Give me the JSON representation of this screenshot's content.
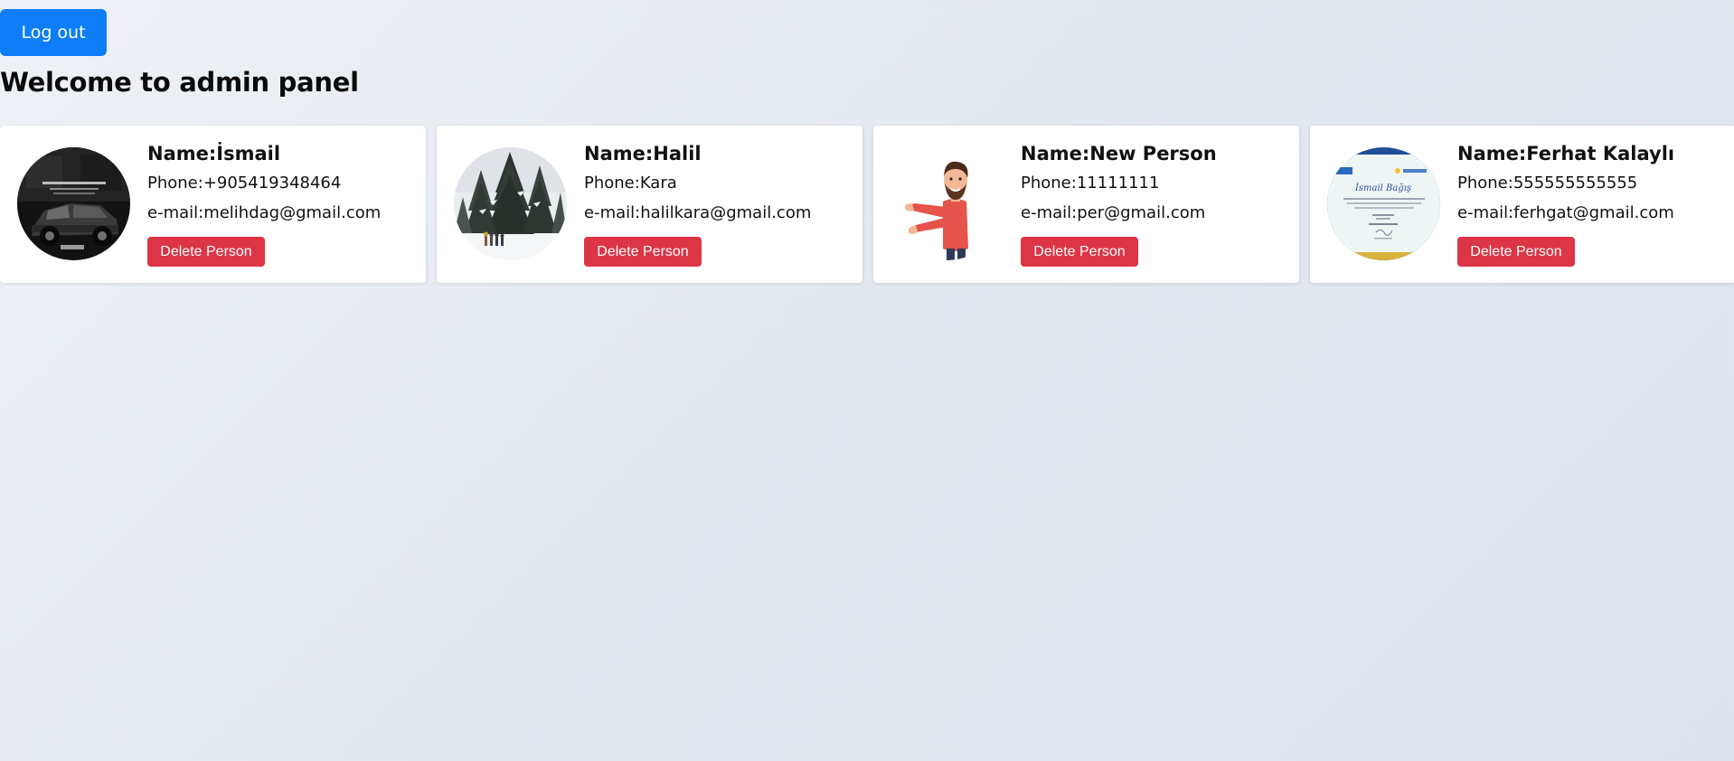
{
  "header": {
    "logout_label": "Log out",
    "title": "Welcome to admin panel"
  },
  "cards": [
    {
      "name": "Name:İsmail",
      "phone": "Phone:+905419348464",
      "email": "e-mail:melihdag@gmail.com",
      "delete_label": "Delete Person",
      "avatar_desc": "car-photo",
      "avatar_caption": "",
      "avatar_caption2": ""
    },
    {
      "name": "Name:Halil",
      "phone": "Phone:Kara",
      "email": "e-mail:halilkara@gmail.com",
      "delete_label": "Delete Person",
      "avatar_desc": "snowy-forest-photo"
    },
    {
      "name": "Name:New Person",
      "phone": "Phone:11111111",
      "email": "e-mail:per@gmail.com",
      "delete_label": "Delete Person",
      "avatar_desc": "cartoon-man-illustration"
    },
    {
      "name": "Name:Ferhat Kalaylı",
      "phone": "Phone:555555555555",
      "email": "e-mail:ferhgat@gmail.com",
      "delete_label": "Delete Person",
      "avatar_desc": "certificate-document",
      "avatar_heading": "İsmail Bağış"
    }
  ],
  "colors": {
    "primary": "#0d7ef8",
    "danger": "#dc3545",
    "card_bg": "#ffffff"
  }
}
